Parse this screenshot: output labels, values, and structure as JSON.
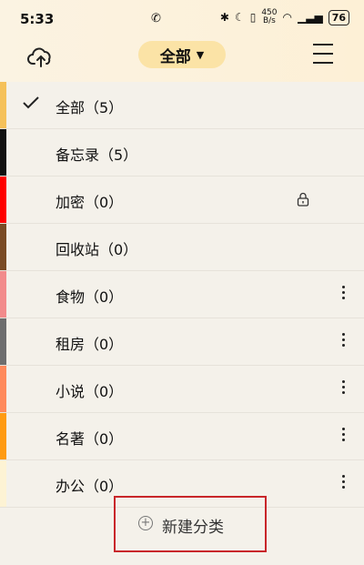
{
  "status_bar": {
    "time": "5:33",
    "network_speed_value": "450",
    "network_speed_unit": "B/s",
    "battery": "76"
  },
  "header": {
    "filter_label": "全部",
    "filter_caret": "▼"
  },
  "categories": [
    {
      "label": "全部（5）",
      "selected": true,
      "stripe": "#f5c15a",
      "action": "none"
    },
    {
      "label": "备忘录（5）",
      "selected": false,
      "stripe": "#111111",
      "action": "none"
    },
    {
      "label": "加密（0）",
      "selected": false,
      "stripe": "#ff0000",
      "action": "lock"
    },
    {
      "label": "回收站（0）",
      "selected": false,
      "stripe": "#7a4b25",
      "action": "none"
    },
    {
      "label": "食物（0）",
      "selected": false,
      "stripe": "#f28b8b",
      "action": "more"
    },
    {
      "label": "租房（0）",
      "selected": false,
      "stripe": "#6e6e6e",
      "action": "more"
    },
    {
      "label": "小说（0）",
      "selected": false,
      "stripe": "#ff8a5c",
      "action": "more"
    },
    {
      "label": "名著（0）",
      "selected": false,
      "stripe": "#ff9b12",
      "action": "more"
    },
    {
      "label": "办公（0）",
      "selected": false,
      "stripe": "#fdf3d4",
      "action": "more"
    }
  ],
  "new_category": {
    "label": "新建分类",
    "plus": "+"
  },
  "colors": {
    "highlight_border": "#c8262a",
    "pill_bg": "#fbe3a6"
  }
}
